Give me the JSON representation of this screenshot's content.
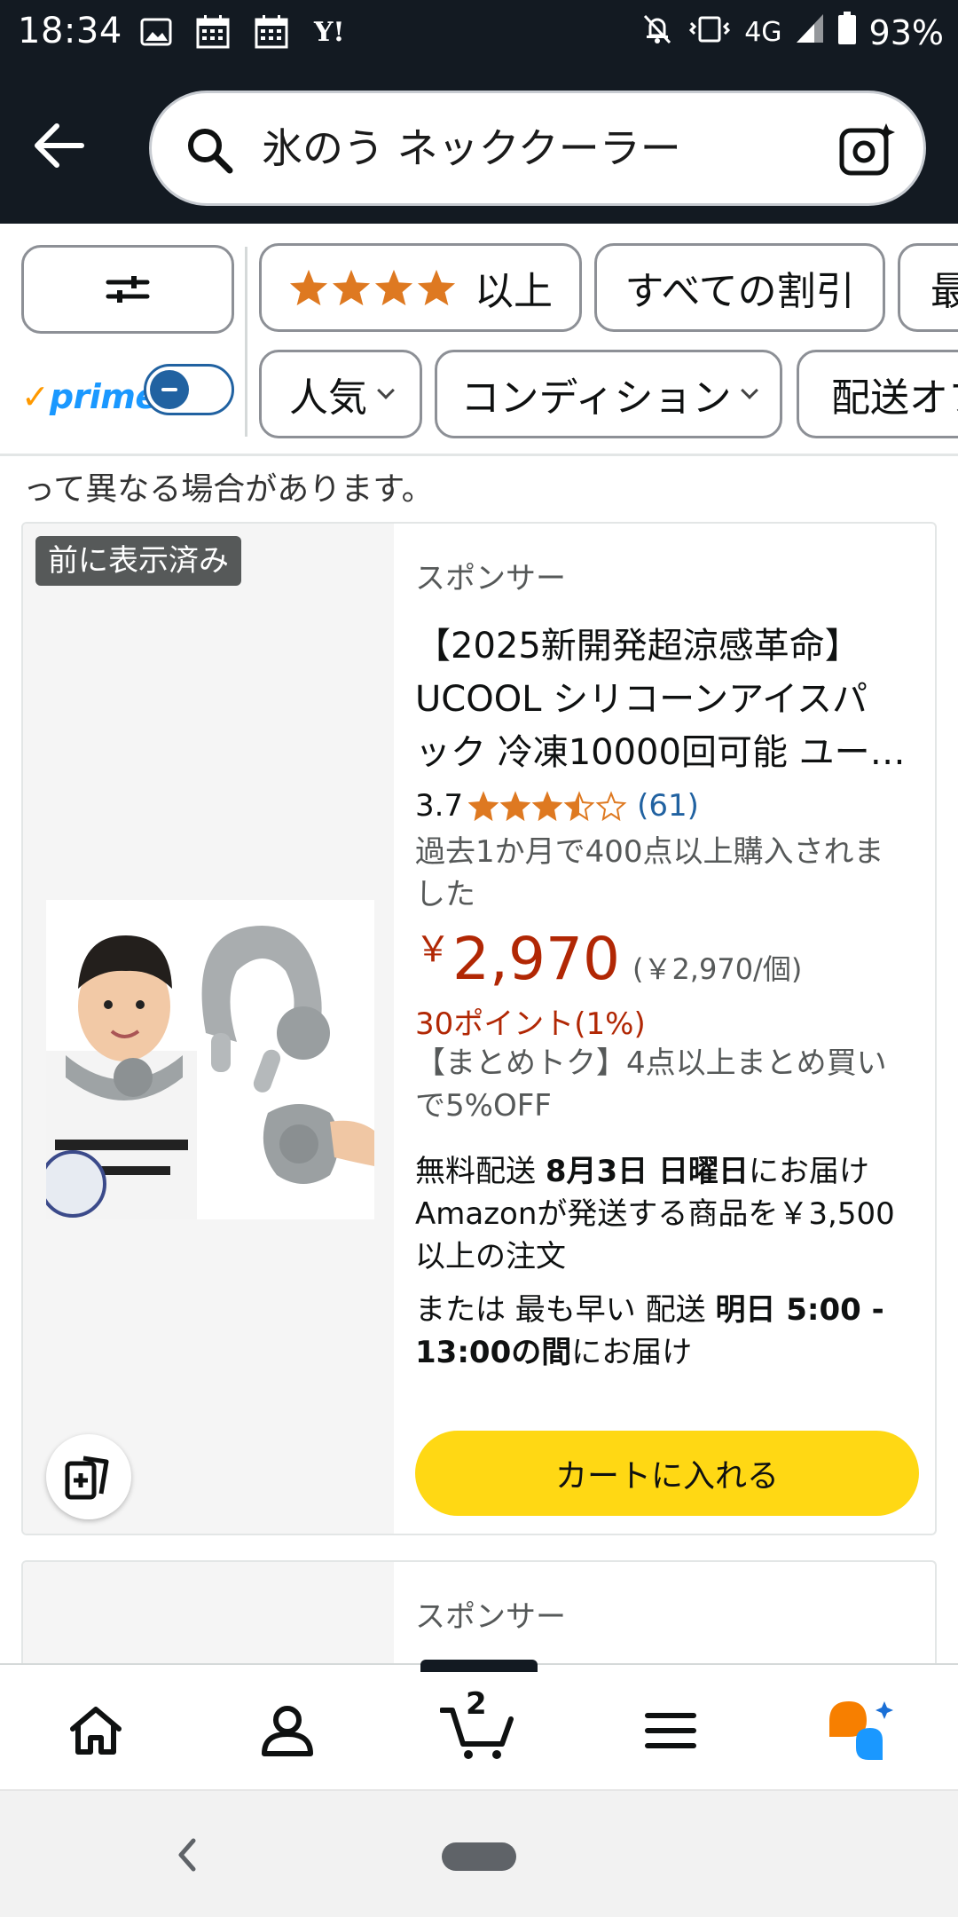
{
  "status_bar": {
    "time": "18:34",
    "network": "4G",
    "battery": "93%",
    "left_icons": [
      "image-icon",
      "calendar-icon",
      "calendar-icon",
      "yahoo-icon"
    ],
    "right_icons": [
      "bell-off-icon",
      "vibrate-icon",
      "signal-icon",
      "battery-icon"
    ]
  },
  "header": {
    "search_query": "氷のう ネッククーラー"
  },
  "filters": {
    "rating_filter_label": "以上",
    "rating_filter_stars": 4,
    "discount_label": "すべての割引",
    "partial_label_row1": "最",
    "prime_tick": "✓",
    "prime_word": "prime",
    "prime_toggle_on": false,
    "popular_label": "人気",
    "condition_label": "コンディション",
    "shipping_label": "配送オプ"
  },
  "results_note": "って異なる場合があります。",
  "product": {
    "viewed_badge": "前に表示済み",
    "sponsored_label": "スポンサー",
    "title_line1": "【2025新開発超涼感革命】",
    "title_line2": "UCOOL シリコーンアイスパ",
    "title_line3": "ック 冷凍10000回可能 ユー…",
    "rating_value": "3.7",
    "rating_stars": 3.5,
    "rating_count": "(61)",
    "bought_text": "過去1か月で400点以上購入されました",
    "price_symbol": "￥",
    "price_amount": "2,970",
    "unit_price": "(￥2,970/個)",
    "points_text": "30ポイント(1%)",
    "bundle_text": "【まとめトク】4点以上まとめ買いで5%OFF",
    "delivery_prefix": "無料配送 ",
    "delivery_date": "8月3日 日曜日",
    "delivery_suffix": "にお届け",
    "delivery_condition": "Amazonが発送する商品を￥3,500以上の注文",
    "fastest_prefix": "または 最も早い 配送 ",
    "fastest_time": "明日 5:00 - 13:00の間",
    "fastest_suffix": "にお届け",
    "add_to_cart_label": "カートに入れる"
  },
  "next_product": {
    "sponsored_label": "スポンサー"
  },
  "bottom_nav": {
    "cart_count": "2",
    "active_tab": "cart"
  },
  "colors": {
    "header_bg": "#131a22",
    "price_red": "#b12704",
    "star_orange": "#de7921",
    "cart_button": "#ffd814",
    "prime_blue": "#1a98ff",
    "link_blue": "#2162a1"
  }
}
